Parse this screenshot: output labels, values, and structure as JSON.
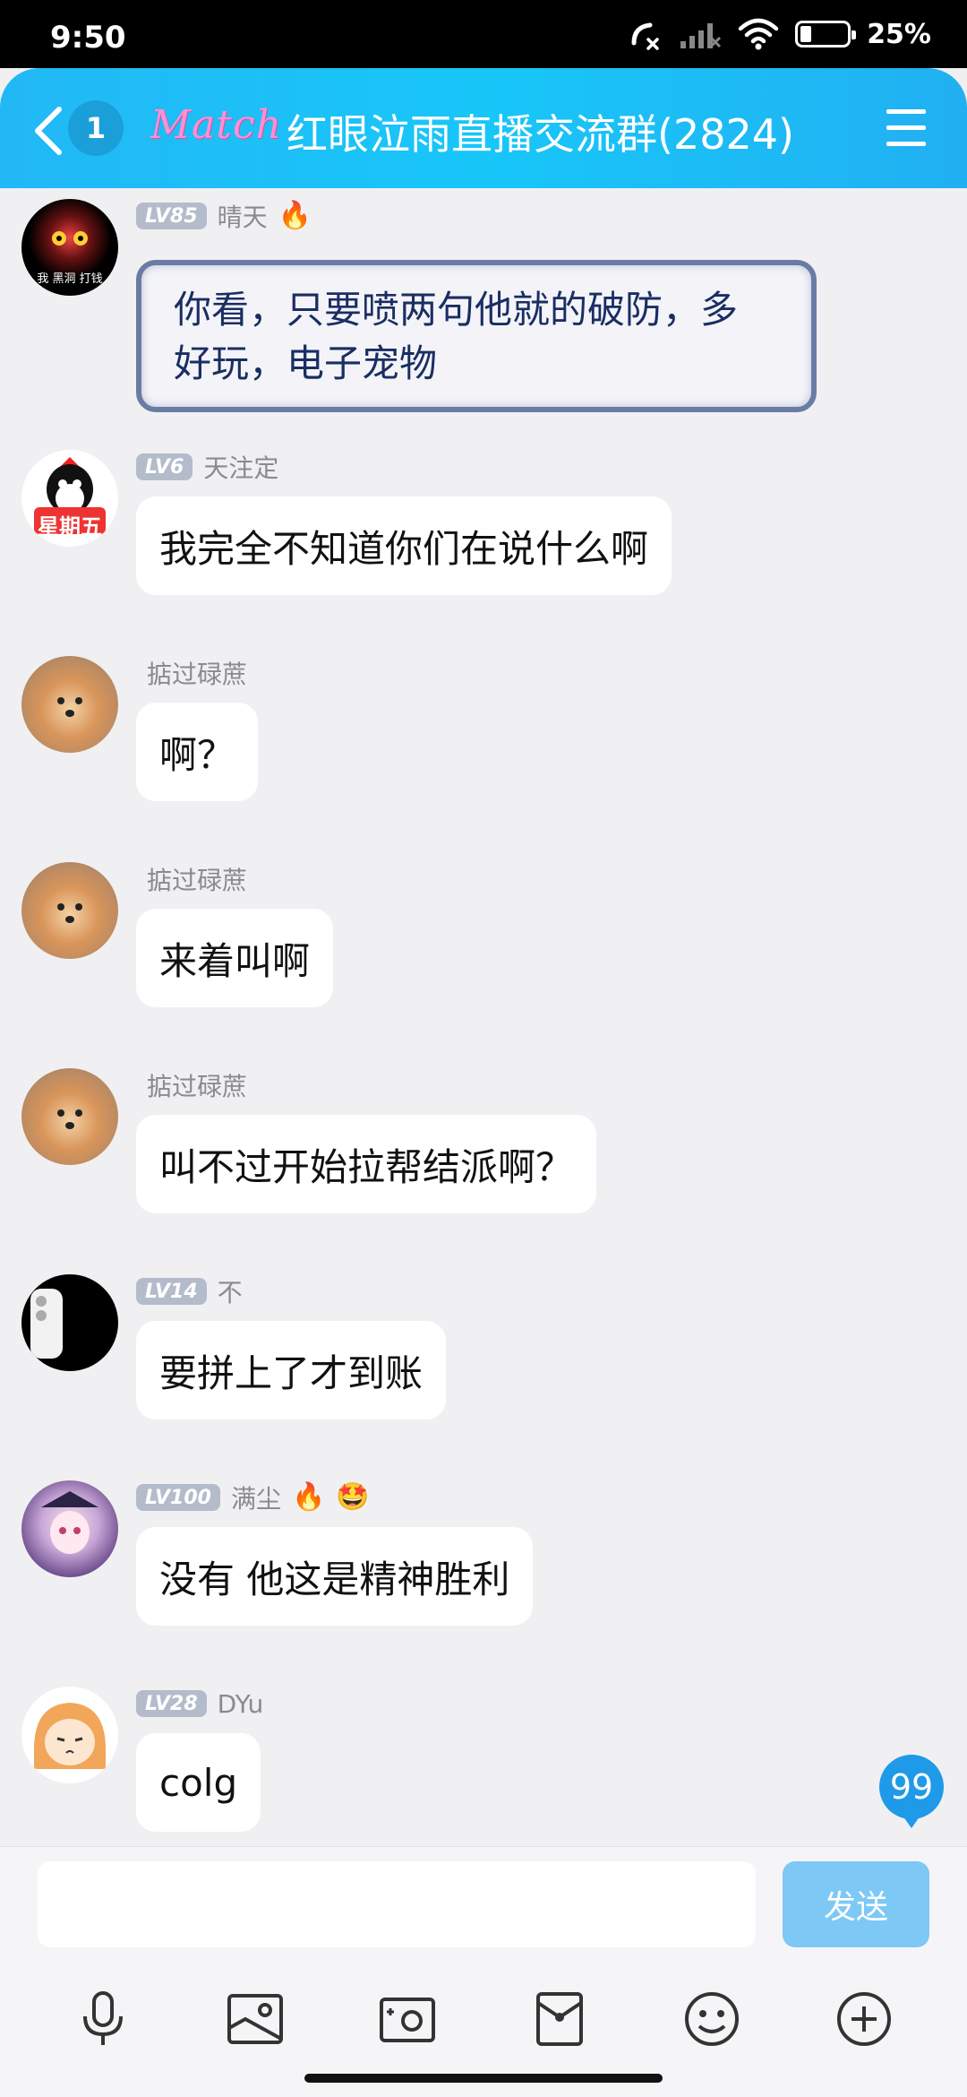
{
  "status_bar": {
    "time": "9:50",
    "battery": "25%"
  },
  "header": {
    "unread_count": "1",
    "logo_text": "Match",
    "title": "红眼泣雨直播交流群(2824)"
  },
  "messages": [
    {
      "level": "LV85",
      "name": "晴天",
      "badge": "🔥",
      "text_line1": "你看，只要喷两句他就的破防，多",
      "text_line2": "好玩，电子宠物",
      "avatar_caption": "我 黑洞 打钱"
    },
    {
      "level": "LV6",
      "name": "天注定",
      "text": "我完全不知道你们在说什么啊",
      "avatar_caption": "星期五"
    },
    {
      "name": "掂过碌蔗",
      "text": "啊？"
    },
    {
      "name": "掂过碌蔗",
      "text": "来着叫啊"
    },
    {
      "name": "掂过碌蔗",
      "text": "叫不过开始拉帮结派啊？"
    },
    {
      "level": "LV14",
      "name": "不",
      "text": "要拼上了才到账"
    },
    {
      "level": "LV100",
      "name": "满尘",
      "badge1": "🔥",
      "badge2": "🤩",
      "text": "没有 他这是精神胜利"
    },
    {
      "level": "LV28",
      "name": "DYu",
      "text": "colg"
    }
  ],
  "unread_bubble": "99",
  "input": {
    "placeholder": "",
    "send_label": "发送"
  },
  "toolbar_icons": [
    "microphone-icon",
    "image-icon",
    "camera-icon",
    "red-packet-icon",
    "emoji-icon",
    "plus-icon"
  ],
  "colors": {
    "header": "#22b8f6",
    "send_button": "#7ec8f5",
    "level_badge": "#b4bccb"
  }
}
